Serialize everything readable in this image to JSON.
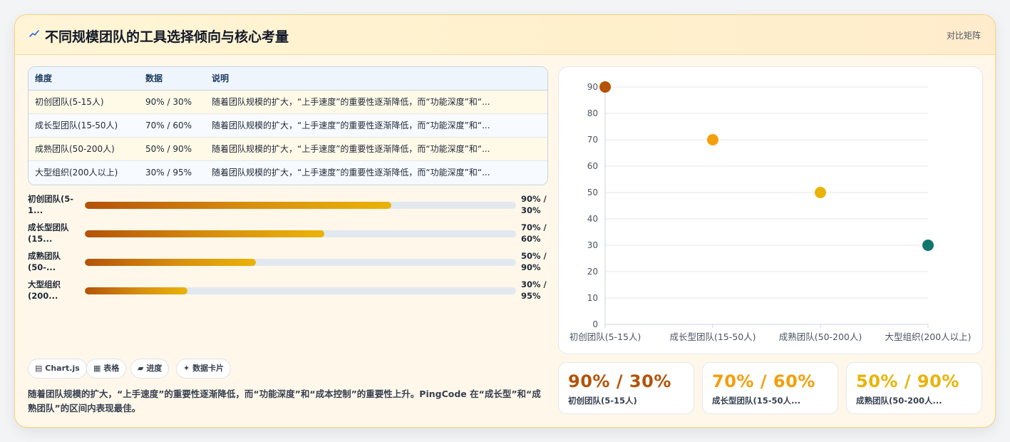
{
  "header": {
    "title": "不同规模团队的工具选择倾向与核心考量",
    "right_label": "对比矩阵",
    "icon": "trend-icon"
  },
  "table": {
    "columns": [
      "维度",
      "数据",
      "说明"
    ],
    "rows": [
      [
        "初创团队(5-15人)",
        "90% / 30%",
        "随着团队规模的扩大，“上手速度”的重要性逐渐降低，而“功能深度”和“..."
      ],
      [
        "成长型团队(15-50人)",
        "70% / 60%",
        "随着团队规模的扩大，“上手速度”的重要性逐渐降低，而“功能深度”和“..."
      ],
      [
        "成熟团队(50-200人)",
        "50% / 90%",
        "随着团队规模的扩大，“上手速度”的重要性逐渐降低，而“功能深度”和“..."
      ],
      [
        "大型组织(200人以上)",
        "30% / 95%",
        "随着团队规模的扩大，“上手速度”的重要性逐渐降低，而“功能深度”和“..."
      ]
    ]
  },
  "bars": [
    {
      "label": "初创团队(5-1...",
      "value": "90% / 30%",
      "fill": 0.71
    },
    {
      "label": "成长型团队(15...",
      "value": "70% / 60%",
      "fill": 0.555
    },
    {
      "label": "成熟团队(50-...",
      "value": "50% / 90%",
      "fill": 0.397
    },
    {
      "label": "大型组织(200...",
      "value": "30% / 95%",
      "fill": 0.238
    }
  ],
  "chips": [
    {
      "icon": "▤",
      "label": "Chart.js"
    },
    {
      "icon": "▦",
      "label": "表格"
    },
    {
      "icon": "▰",
      "label": "进度"
    },
    {
      "icon": "✦",
      "label": "数据卡片"
    }
  ],
  "summary": "随着团队规模的扩大，“上手速度”的重要性逐渐降低，而“功能深度”和“成本控制”的重要性上升。PingCode 在“成长型”和“成熟团队”的区间内表现最佳。",
  "stats": [
    {
      "value": "90% / 30%",
      "label": "初创团队(5-15人)",
      "color": "#b45309"
    },
    {
      "value": "70% / 60%",
      "label": "成长型团队(15-50人...",
      "color": "#f59e0b"
    },
    {
      "value": "50% / 90%",
      "label": "成熟团队(50-200人...",
      "color": "#eab308"
    }
  ],
  "chart_data": {
    "type": "scatter",
    "categories": [
      "初创团队(5-15人)",
      "成长型团队(15-50人)",
      "成熟团队(50-200人)",
      "大型组织(200人以上)"
    ],
    "values": [
      90,
      70,
      50,
      30
    ],
    "point_colors": [
      "#b45309",
      "#f59e0b",
      "#eab308",
      "#0f766e"
    ],
    "ylim": [
      0,
      90
    ],
    "yticks": [
      0,
      10,
      20,
      30,
      40,
      50,
      60,
      70,
      80,
      90
    ],
    "grid": true,
    "legend": "none",
    "title": "",
    "xlabel": "",
    "ylabel": ""
  }
}
